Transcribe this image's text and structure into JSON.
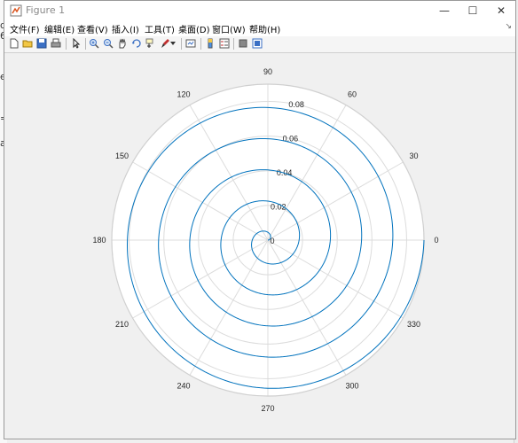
{
  "window": {
    "title": "Figure 1"
  },
  "window_controls": {
    "minimize": "—",
    "maximize": "☐",
    "close": "✕"
  },
  "menu": {
    "items": [
      {
        "label": "文件(F)"
      },
      {
        "label": "编辑(E)"
      },
      {
        "label": "查看(V)"
      },
      {
        "label": "插入(I)"
      },
      {
        "label": "工具(T)"
      },
      {
        "label": "桌面(D)"
      },
      {
        "label": "窗口(W)"
      },
      {
        "label": "帮助(H)"
      }
    ],
    "overflow_arrow": "↘"
  },
  "toolbar": {
    "buttons": [
      "new-figure-icon",
      "open-icon",
      "save-icon",
      "print-icon",
      "pointer-icon",
      "zoom-in-icon",
      "zoom-out-icon",
      "pan-icon",
      "rotate-3d-icon",
      "data-cursor-icon",
      "brush-icon",
      "brush-dropdown-icon",
      "link-plot-icon",
      "colorbar-icon",
      "legend-icon",
      "hide-plot-tools-icon",
      "show-plot-tools-icon"
    ]
  },
  "background_fragments": [
    "d",
    "6",
    "e",
    "=",
    "a"
  ],
  "colors": {
    "spiral": "#0072BD",
    "grid": "#dcdcdc",
    "axes_bg": "#ffffff",
    "figure_bg": "#f0f0f0"
  },
  "chart_data": {
    "type": "line",
    "coordinate_system": "polar",
    "theta_tick_labels": [
      "0",
      "30",
      "60",
      "90",
      "120",
      "150",
      "180",
      "210",
      "240",
      "270",
      "300",
      "330"
    ],
    "r_tick_labels": [
      "0",
      "0.02",
      "0.04",
      "0.06",
      "0.08"
    ],
    "r_lim": [
      0,
      0.09
    ],
    "theta_range_deg": [
      0,
      1800
    ],
    "r_at_end": 0.09,
    "series": [
      {
        "description": "Archimedean spiral r = 0.09 * theta / (10*pi), theta from 0 to 10*pi",
        "turns": 5
      }
    ],
    "grid": true
  }
}
